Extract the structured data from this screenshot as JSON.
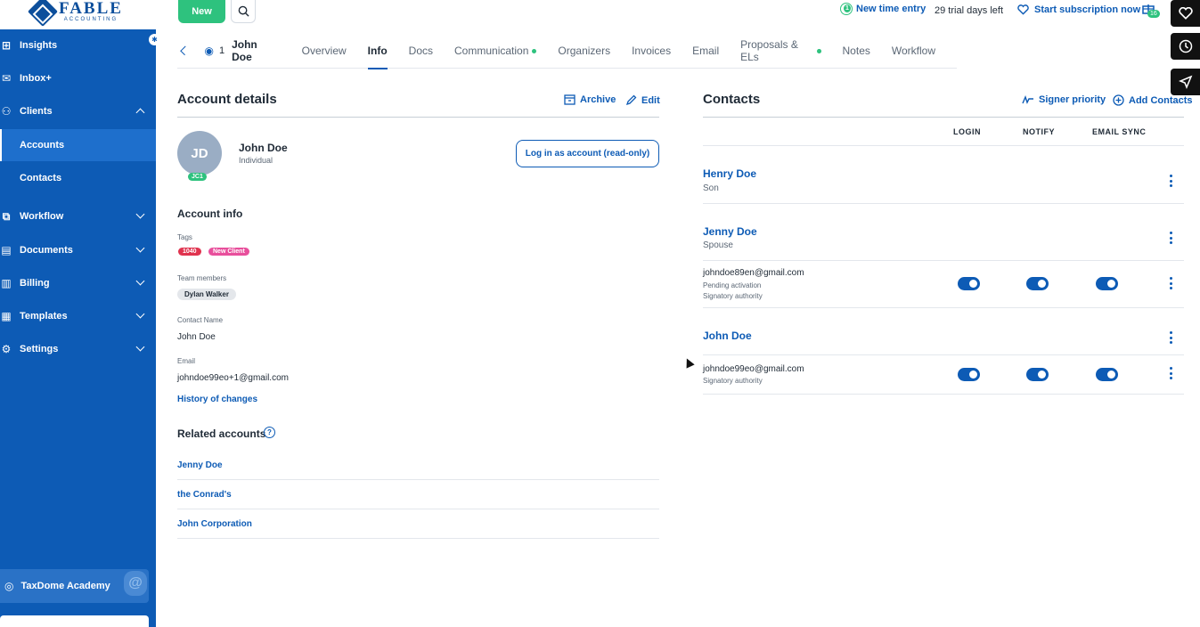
{
  "logo": {
    "brand": "FABLE",
    "sub": "ACCOUNTING"
  },
  "topbar": {
    "new_label": "New",
    "time_entry_badge": "1",
    "time_entry_label": "New time entry",
    "trial_text": "29 trial days left",
    "subscription_label": "Start subscription now",
    "gift_badge": "16"
  },
  "sidebar": {
    "items": [
      {
        "label": "Insights",
        "icon": "grid-icon"
      },
      {
        "label": "Inbox+",
        "icon": "inbox-icon"
      },
      {
        "label": "Clients",
        "icon": "clients-icon",
        "expanded": true
      },
      {
        "label": "Workflow",
        "icon": "workflow-icon"
      },
      {
        "label": "Documents",
        "icon": "documents-icon"
      },
      {
        "label": "Billing",
        "icon": "billing-icon"
      },
      {
        "label": "Templates",
        "icon": "templates-icon"
      },
      {
        "label": "Settings",
        "icon": "settings-icon"
      }
    ],
    "sub_items": [
      {
        "label": "Accounts",
        "active": true
      },
      {
        "label": "Contacts",
        "active": false
      }
    ],
    "academy_label": "TaxDome Academy"
  },
  "tabs": {
    "viewers_count": "1",
    "client_name": "John Doe",
    "items": [
      {
        "label": "Overview",
        "active": false,
        "dot": false
      },
      {
        "label": "Info",
        "active": true,
        "dot": false
      },
      {
        "label": "Docs",
        "active": false,
        "dot": false
      },
      {
        "label": "Communication",
        "active": false,
        "dot": true
      },
      {
        "label": "Organizers",
        "active": false,
        "dot": false
      },
      {
        "label": "Invoices",
        "active": false,
        "dot": false
      },
      {
        "label": "Email",
        "active": false,
        "dot": false
      },
      {
        "label": "Proposals & ELs",
        "active": false,
        "dot": true
      },
      {
        "label": "Notes",
        "active": false,
        "dot": false
      },
      {
        "label": "Workflow",
        "active": false,
        "dot": false
      }
    ]
  },
  "account": {
    "title": "Account details",
    "archive_label": "Archive",
    "edit_label": "Edit",
    "initials": "JD",
    "badge": "JC1",
    "name": "John Doe",
    "type": "Individual",
    "login_label": "Log in as account (read-only)",
    "info_title": "Account info",
    "tags_label": "Tags",
    "tags": [
      {
        "text": "1040",
        "color": "#e0334f"
      },
      {
        "text": "New Client",
        "color": "#e84f9c"
      }
    ],
    "team_label": "Team members",
    "team_member": "Dylan Walker",
    "contact_name_label": "Contact Name",
    "contact_name": "John Doe",
    "email_label": "Email",
    "email": "johndoe99eo+1@gmail.com",
    "history_label": "History of changes",
    "related_title": "Related accounts",
    "related": [
      "Jenny Doe",
      "the Conrad's",
      "John Corporation"
    ]
  },
  "contacts": {
    "title": "Contacts",
    "signer_label": "Signer priority",
    "add_label": "Add Contacts",
    "columns": [
      "LOGIN",
      "NOTIFY",
      "EMAIL SYNC"
    ],
    "people": [
      {
        "name": "Henry Doe",
        "relation": "Son"
      },
      {
        "name": "Jenny Doe",
        "relation": "Spouse",
        "email": "johndoe89en@gmail.com",
        "status": "Pending activation",
        "role": "Signatory authority"
      },
      {
        "name": "John Doe",
        "relation": "",
        "email": "johndoe99eo@gmail.com",
        "role": "Signatory authority"
      }
    ]
  },
  "colors": {
    "primary": "#0d5bb5",
    "success": "#2ec27e",
    "sidebar": "#0d5bb5"
  }
}
